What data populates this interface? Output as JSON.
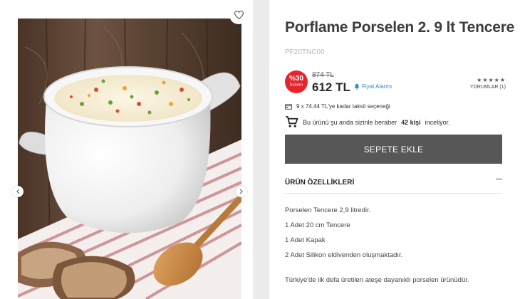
{
  "product": {
    "title": "Porflame Porselen 2. 9 lt Tencere",
    "sku": "PF20TNC00"
  },
  "pricing": {
    "discount_percent": "%30",
    "discount_label": "İndirim",
    "old_price": "874 TL",
    "new_price": "612 TL",
    "price_alarm_label": "Fiyat Alarmı"
  },
  "rating": {
    "stars": 5,
    "stars_text": "★★★★★",
    "reviews_label": "YORUMLAR (1)"
  },
  "installment": {
    "text": "9 x 74.44 TL'ye kadar taksit seçeneği"
  },
  "viewers": {
    "prefix": "Bu ürünü şu anda sizinle beraber",
    "count": "42 kişi",
    "suffix": "inceliyor."
  },
  "cart": {
    "button_label": "SEPETE EKLE"
  },
  "features": {
    "heading": "ÜRÜN ÖZELLİKLERİ",
    "lines": [
      "Porselen Tencere 2,9 litredir.",
      "1 Adet 20 cm Tencere",
      "1 Adet Kapak",
      "2 Adet Silikon eldivenden oluşmaktadır.",
      "Türkiye'de ilk defa üretilen ateşe dayanıklı porselen ürünüdür."
    ]
  },
  "icons": {
    "favorite": "heart-outline-icon",
    "prev": "chevron-left-icon",
    "next": "chevron-right-icon",
    "alarm": "bell-icon",
    "installment": "credit-card-icon",
    "viewers": "shopping-cart-icon",
    "collapse": "minus-icon"
  },
  "colors": {
    "discount_badge": "#e5242c",
    "cart_button": "#575757",
    "alarm_link": "#2a8fbd",
    "page_background": "#ececec"
  }
}
